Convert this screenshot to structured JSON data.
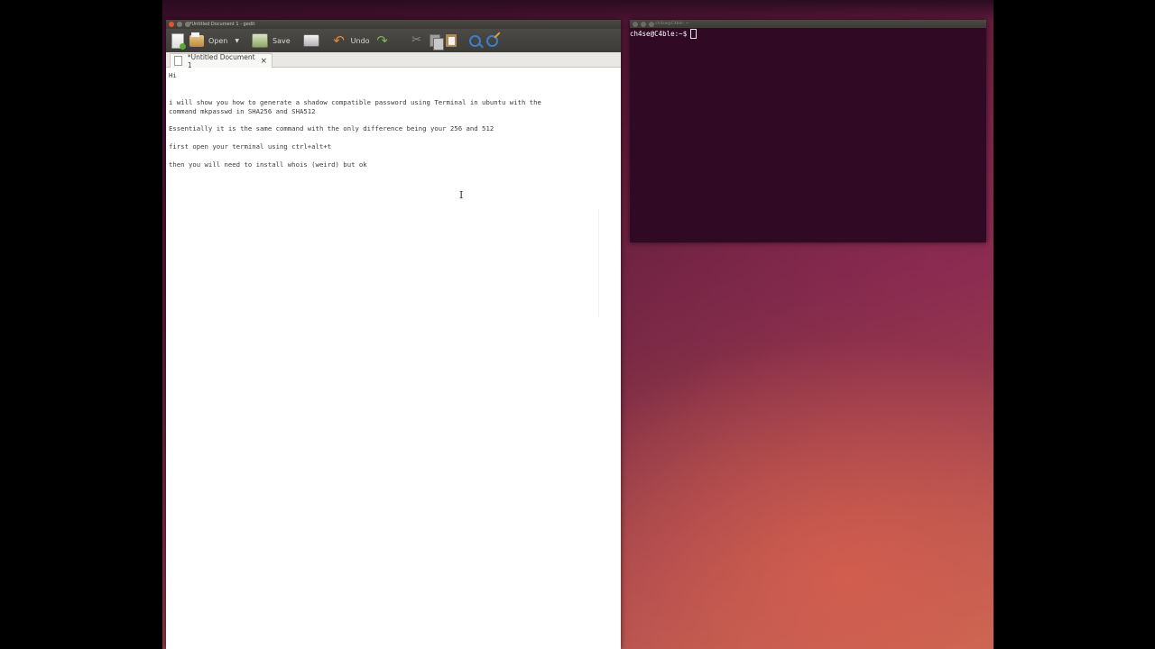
{
  "gedit": {
    "title": "*Untitled Document 1 - gedit",
    "toolbar": {
      "open_label": "Open",
      "save_label": "Save",
      "undo_label": "Undo"
    },
    "tab": {
      "label": "*Untitled Document 1",
      "close": "×"
    },
    "lines": [
      "Hi",
      "i will show you how to generate a shadow compatible password using Terminal in ubuntu with the",
      "command mkpasswd in SHA256 and SHA512",
      "Essentially it is the same command with the only difference being your 256 and 512",
      "first open your terminal using ctrl+alt+t",
      "then you will need to install whois (weird) but ok"
    ],
    "text_cursor": "I"
  },
  "terminal": {
    "title": "ch4se@C4ble: ~",
    "prompt": "ch4se@C4ble:~$"
  },
  "colors": {
    "terminal_bg": "#300a24",
    "close_button": "#e1552c",
    "toolbar": "#3d3c38"
  }
}
